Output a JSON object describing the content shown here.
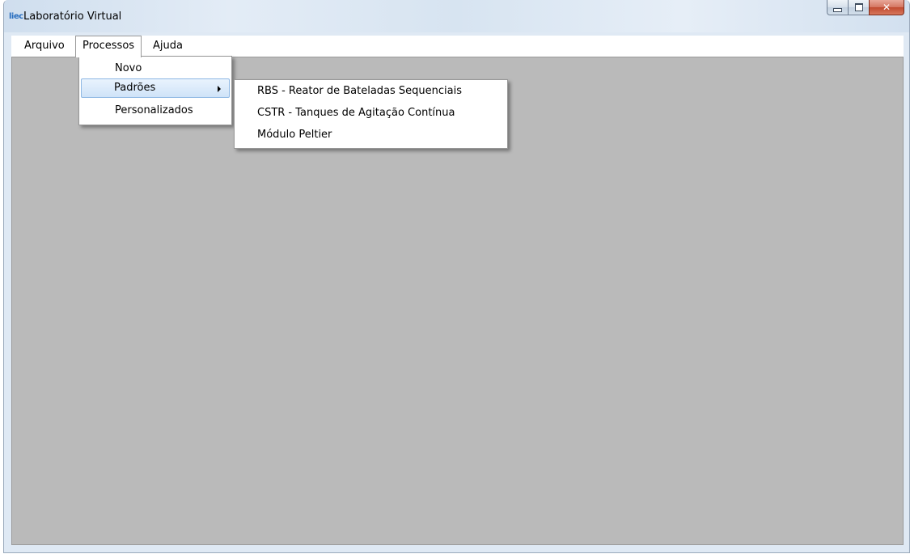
{
  "window": {
    "logo": "liec",
    "title": "Laboratório Virtual",
    "controls": {
      "minimize": "minimize-icon",
      "maximize": "maximize-icon",
      "close": "close-icon",
      "close_glyph": "✕"
    }
  },
  "menubar": {
    "items": [
      {
        "label": "Arquivo"
      },
      {
        "label": "Processos"
      },
      {
        "label": "Ajuda"
      }
    ]
  },
  "processos_menu": {
    "items": [
      {
        "label": "Novo"
      },
      {
        "label": "Padrões"
      },
      {
        "label": "Personalizados"
      }
    ]
  },
  "padroes_submenu": {
    "items": [
      {
        "label": "RBS - Reator de Bateladas Sequenciais"
      },
      {
        "label": "CSTR - Tanques de Agitação Contínua"
      },
      {
        "label": "Módulo Peltier"
      }
    ]
  },
  "colors": {
    "client_background": "#bababa",
    "highlight": "#cfe3f8",
    "close_button": "#c14a2f"
  }
}
